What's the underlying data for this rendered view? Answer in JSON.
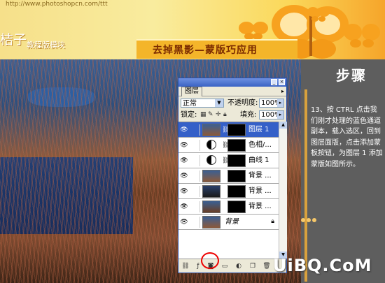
{
  "header": {
    "url": "http://www.photoshopcn.com/ttt",
    "brand": "桔子",
    "subtitle": "教程版模块",
    "title": "去掉黑影—蒙版巧应用"
  },
  "watermark": "UiBQ.CoM",
  "step": {
    "heading": "步骤",
    "text": "13、按 CTRL 点击我们刚才处理的蓝色通道副本，载入选区，回到图层面版，点击添加蒙板按钮，为图层 1 添加蒙版如图所示。"
  },
  "layers_panel": {
    "tab": "图层",
    "blend_mode": "正常",
    "opacity_label": "不透明度:",
    "opacity_value": "100%",
    "lock_label": "锁定:",
    "fill_label": "填充:",
    "fill_value": "100%",
    "layers": [
      {
        "name": "图层 1",
        "active": true
      },
      {
        "name": "色相/..."
      },
      {
        "name": "曲线 1"
      },
      {
        "name": "背景 ..."
      },
      {
        "name": "背景 ..."
      },
      {
        "name": "背景 ..."
      },
      {
        "name": "背景"
      }
    ]
  },
  "colors": {
    "accent": "#f4b52a",
    "selection": "#3560c8",
    "highlight_circle": "#e00000"
  }
}
